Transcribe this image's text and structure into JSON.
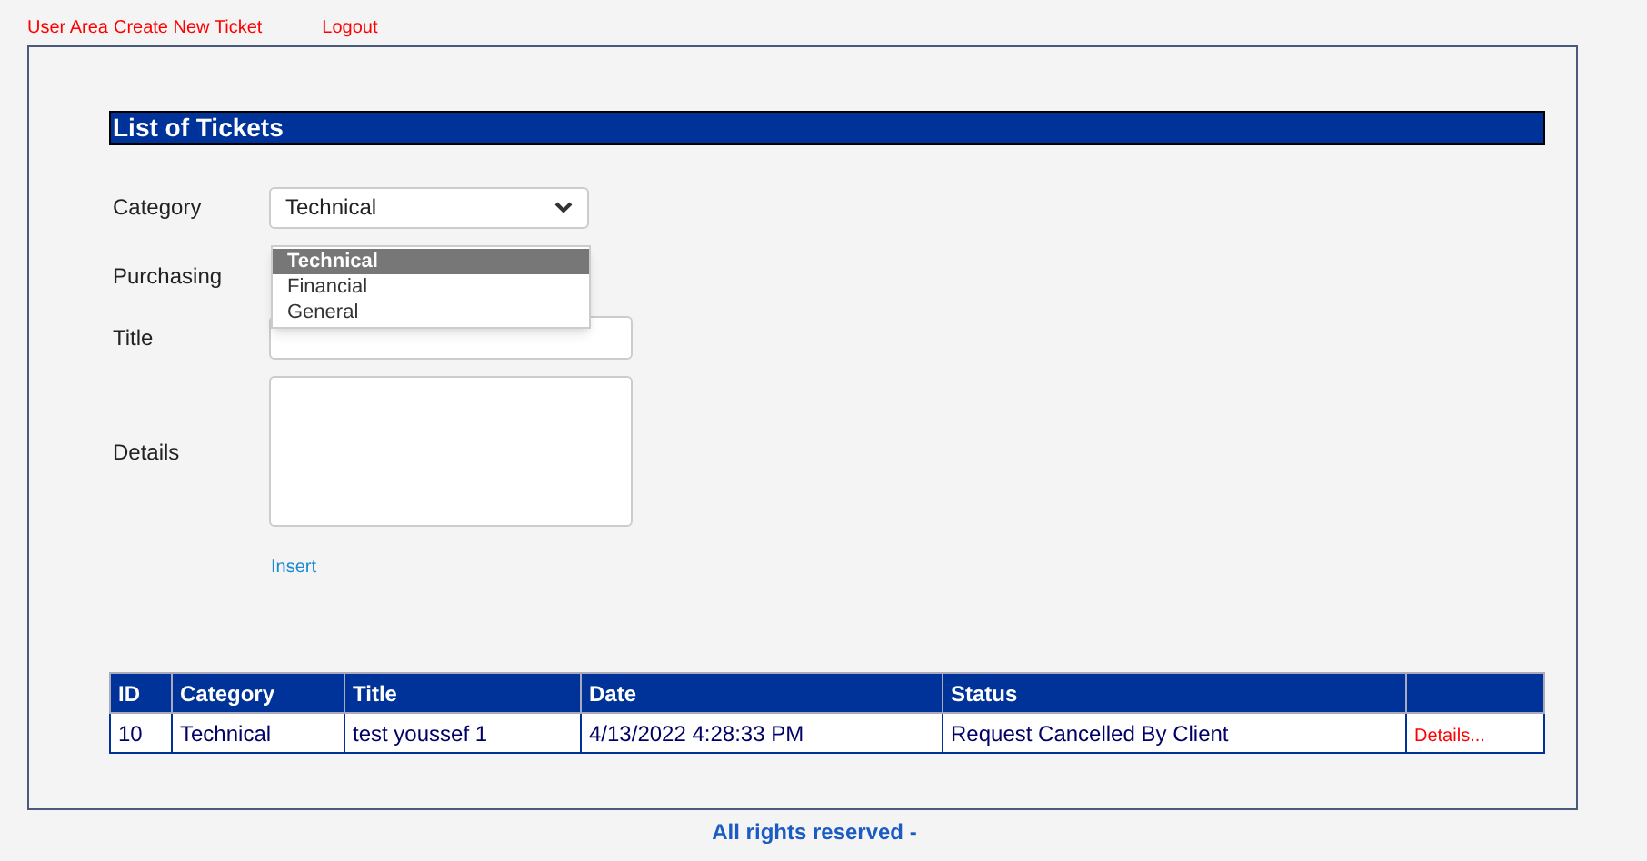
{
  "nav": [
    "User Area",
    "Create New Ticket",
    "Logout"
  ],
  "heading": "List of Tickets",
  "form": {
    "category": {
      "label": "Category",
      "value": "Technical",
      "options": [
        {
          "label": "Technical",
          "selected": true
        },
        {
          "label": "Financial",
          "selected": false
        },
        {
          "label": "General",
          "selected": false
        }
      ]
    },
    "purchasing": {
      "label": "Purchasing"
    },
    "title": {
      "label": "Title"
    },
    "details": {
      "label": "Details"
    },
    "insert": "Insert"
  },
  "table": {
    "columns": [
      "ID",
      "Category",
      "Title",
      "Date",
      "Status",
      ""
    ],
    "rows": [
      {
        "cells": [
          "10",
          "Technical",
          "test youssef 1",
          "4/13/2022 4:28:33 PM",
          "Request Cancelled By Client"
        ],
        "link": "Details..."
      }
    ]
  },
  "footer": "All rights reserved -"
}
